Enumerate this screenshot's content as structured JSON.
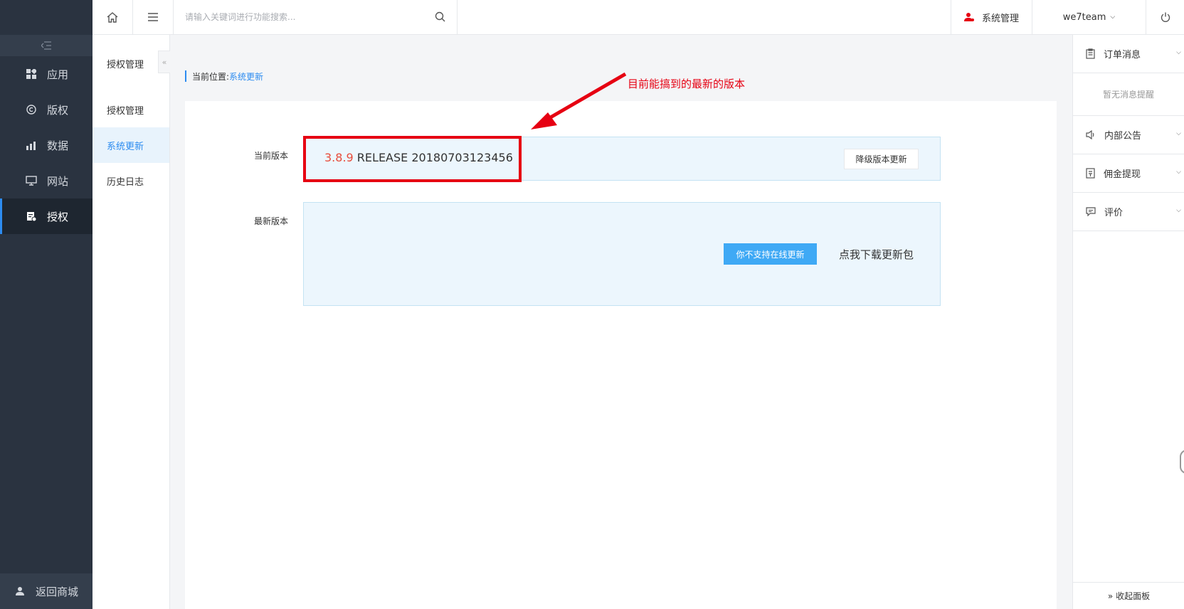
{
  "sidebar": {
    "collapse_icon": "menu-fold-icon",
    "items": [
      {
        "label": "应用",
        "icon": "apps-icon"
      },
      {
        "label": "版权",
        "icon": "copyright-icon"
      },
      {
        "label": "数据",
        "icon": "chart-icon"
      },
      {
        "label": "网站",
        "icon": "monitor-icon"
      },
      {
        "label": "授权",
        "icon": "license-icon",
        "active": true
      }
    ],
    "back_label": "返回商城"
  },
  "topbar": {
    "search_placeholder": "请输入关键词进行功能搜索...",
    "sys_label": "系统管理",
    "user_label": "we7team"
  },
  "subnav": {
    "title": "授权管理",
    "items": [
      {
        "label": "授权管理"
      },
      {
        "label": "系统更新",
        "active": true
      },
      {
        "label": "历史日志"
      }
    ]
  },
  "breadcrumb": {
    "prefix": "当前位置:",
    "current": "系统更新"
  },
  "main": {
    "current_version_label": "当前版本",
    "version_number": "3.8.9",
    "version_rest": " RELEASE 20180703123456",
    "downgrade_label": "降级版本更新",
    "latest_version_label": "最新版本",
    "online_update_label": "你不支持在线更新",
    "download_label": "点我下载更新包",
    "annotation": "目前能搞到的最新的版本"
  },
  "right_panel": {
    "orders_label": "订单消息",
    "orders_empty": "暂无消息提醒",
    "notice_label": "内部公告",
    "commission_label": "佣金提现",
    "review_label": "评价",
    "collapse_label": "» 收起面板"
  },
  "colors": {
    "sidebar_bg": "#2a3340",
    "accent": "#2d8cf0",
    "highlight_red": "#e60012",
    "button_blue": "#3fa9f5"
  }
}
